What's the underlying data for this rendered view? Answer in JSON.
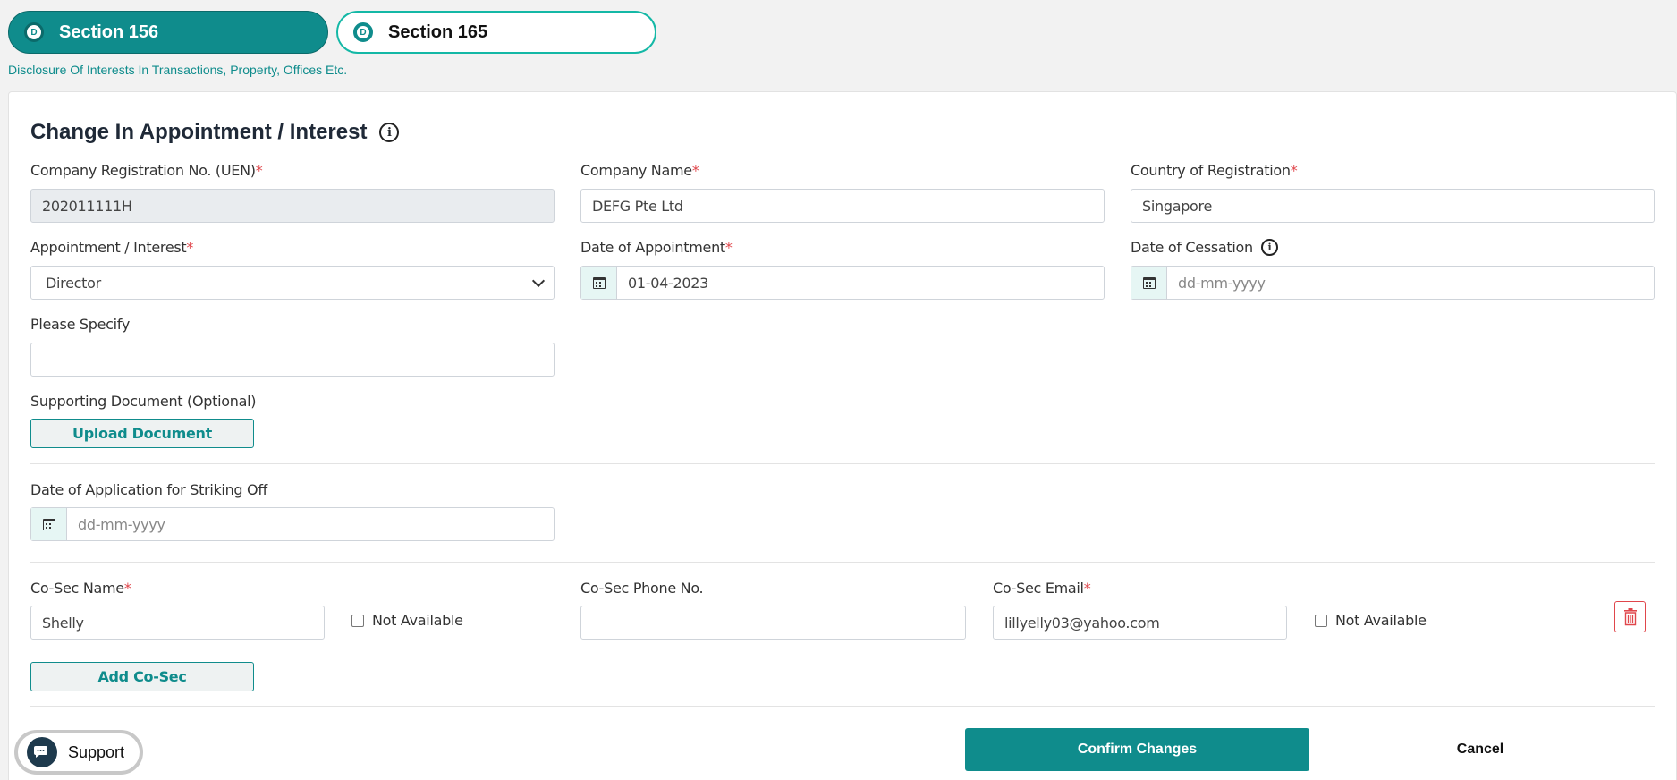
{
  "tabs": [
    {
      "badge": "D",
      "label": "Section 156",
      "active": true
    },
    {
      "badge": "D",
      "label": "Section 165",
      "active": false
    }
  ],
  "subtitle": "Disclosure Of Interests In Transactions, Property, Offices Etc.",
  "form": {
    "title": "Change In Appointment / Interest",
    "uen": {
      "label": "Company Registration No. (UEN)",
      "value": "202011111H"
    },
    "company_name": {
      "label": "Company Name",
      "value": "DEFG Pte Ltd"
    },
    "country": {
      "label": "Country of Registration",
      "value": "Singapore"
    },
    "appointment": {
      "label": "Appointment / Interest",
      "value": "Director"
    },
    "date_appointment": {
      "label": "Date of Appointment",
      "value": "01-04-2023"
    },
    "date_cessation": {
      "label": "Date of Cessation",
      "placeholder": "dd-mm-yyyy"
    },
    "please_specify": {
      "label": "Please Specify",
      "value": ""
    },
    "supporting_doc": {
      "label": "Supporting Document (Optional)",
      "button": "Upload Document"
    },
    "date_striking": {
      "label": "Date of Application for Striking Off",
      "placeholder": "dd-mm-yyyy"
    },
    "cosec": {
      "name_label": "Co-Sec Name",
      "name_value": "Shelly",
      "phone_label": "Co-Sec Phone No.",
      "phone_value": "",
      "email_label": "Co-Sec Email",
      "email_value": "lillyelly03@yahoo.com",
      "not_available": "Not Available",
      "add_button": "Add Co-Sec"
    },
    "required_mark": "*"
  },
  "actions": {
    "confirm": "Confirm Changes",
    "cancel": "Cancel"
  },
  "support": {
    "label": "Support"
  },
  "colors": {
    "accent": "#0f8c8c",
    "required": "#e0464b"
  }
}
